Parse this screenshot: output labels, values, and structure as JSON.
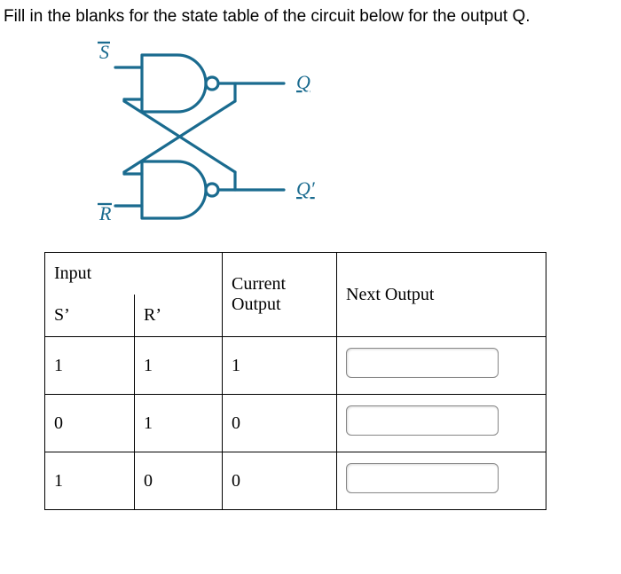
{
  "question": "Fill in the blanks for the state table of the circuit below for the output Q.",
  "diagram": {
    "top_input_label": "S̅",
    "bottom_input_label": "R̅",
    "top_output_label": "Q",
    "bottom_output_label": "Q′",
    "color": "#1a6b8f"
  },
  "table": {
    "headers": {
      "input_group": "Input",
      "s_prime": "S’",
      "r_prime": "R’",
      "current": "Current Output",
      "next": "Next Output"
    },
    "rows": [
      {
        "s": "1",
        "r": "1",
        "cur": "1",
        "next": ""
      },
      {
        "s": "0",
        "r": "1",
        "cur": "0",
        "next": ""
      },
      {
        "s": "1",
        "r": "0",
        "cur": "0",
        "next": ""
      }
    ]
  }
}
